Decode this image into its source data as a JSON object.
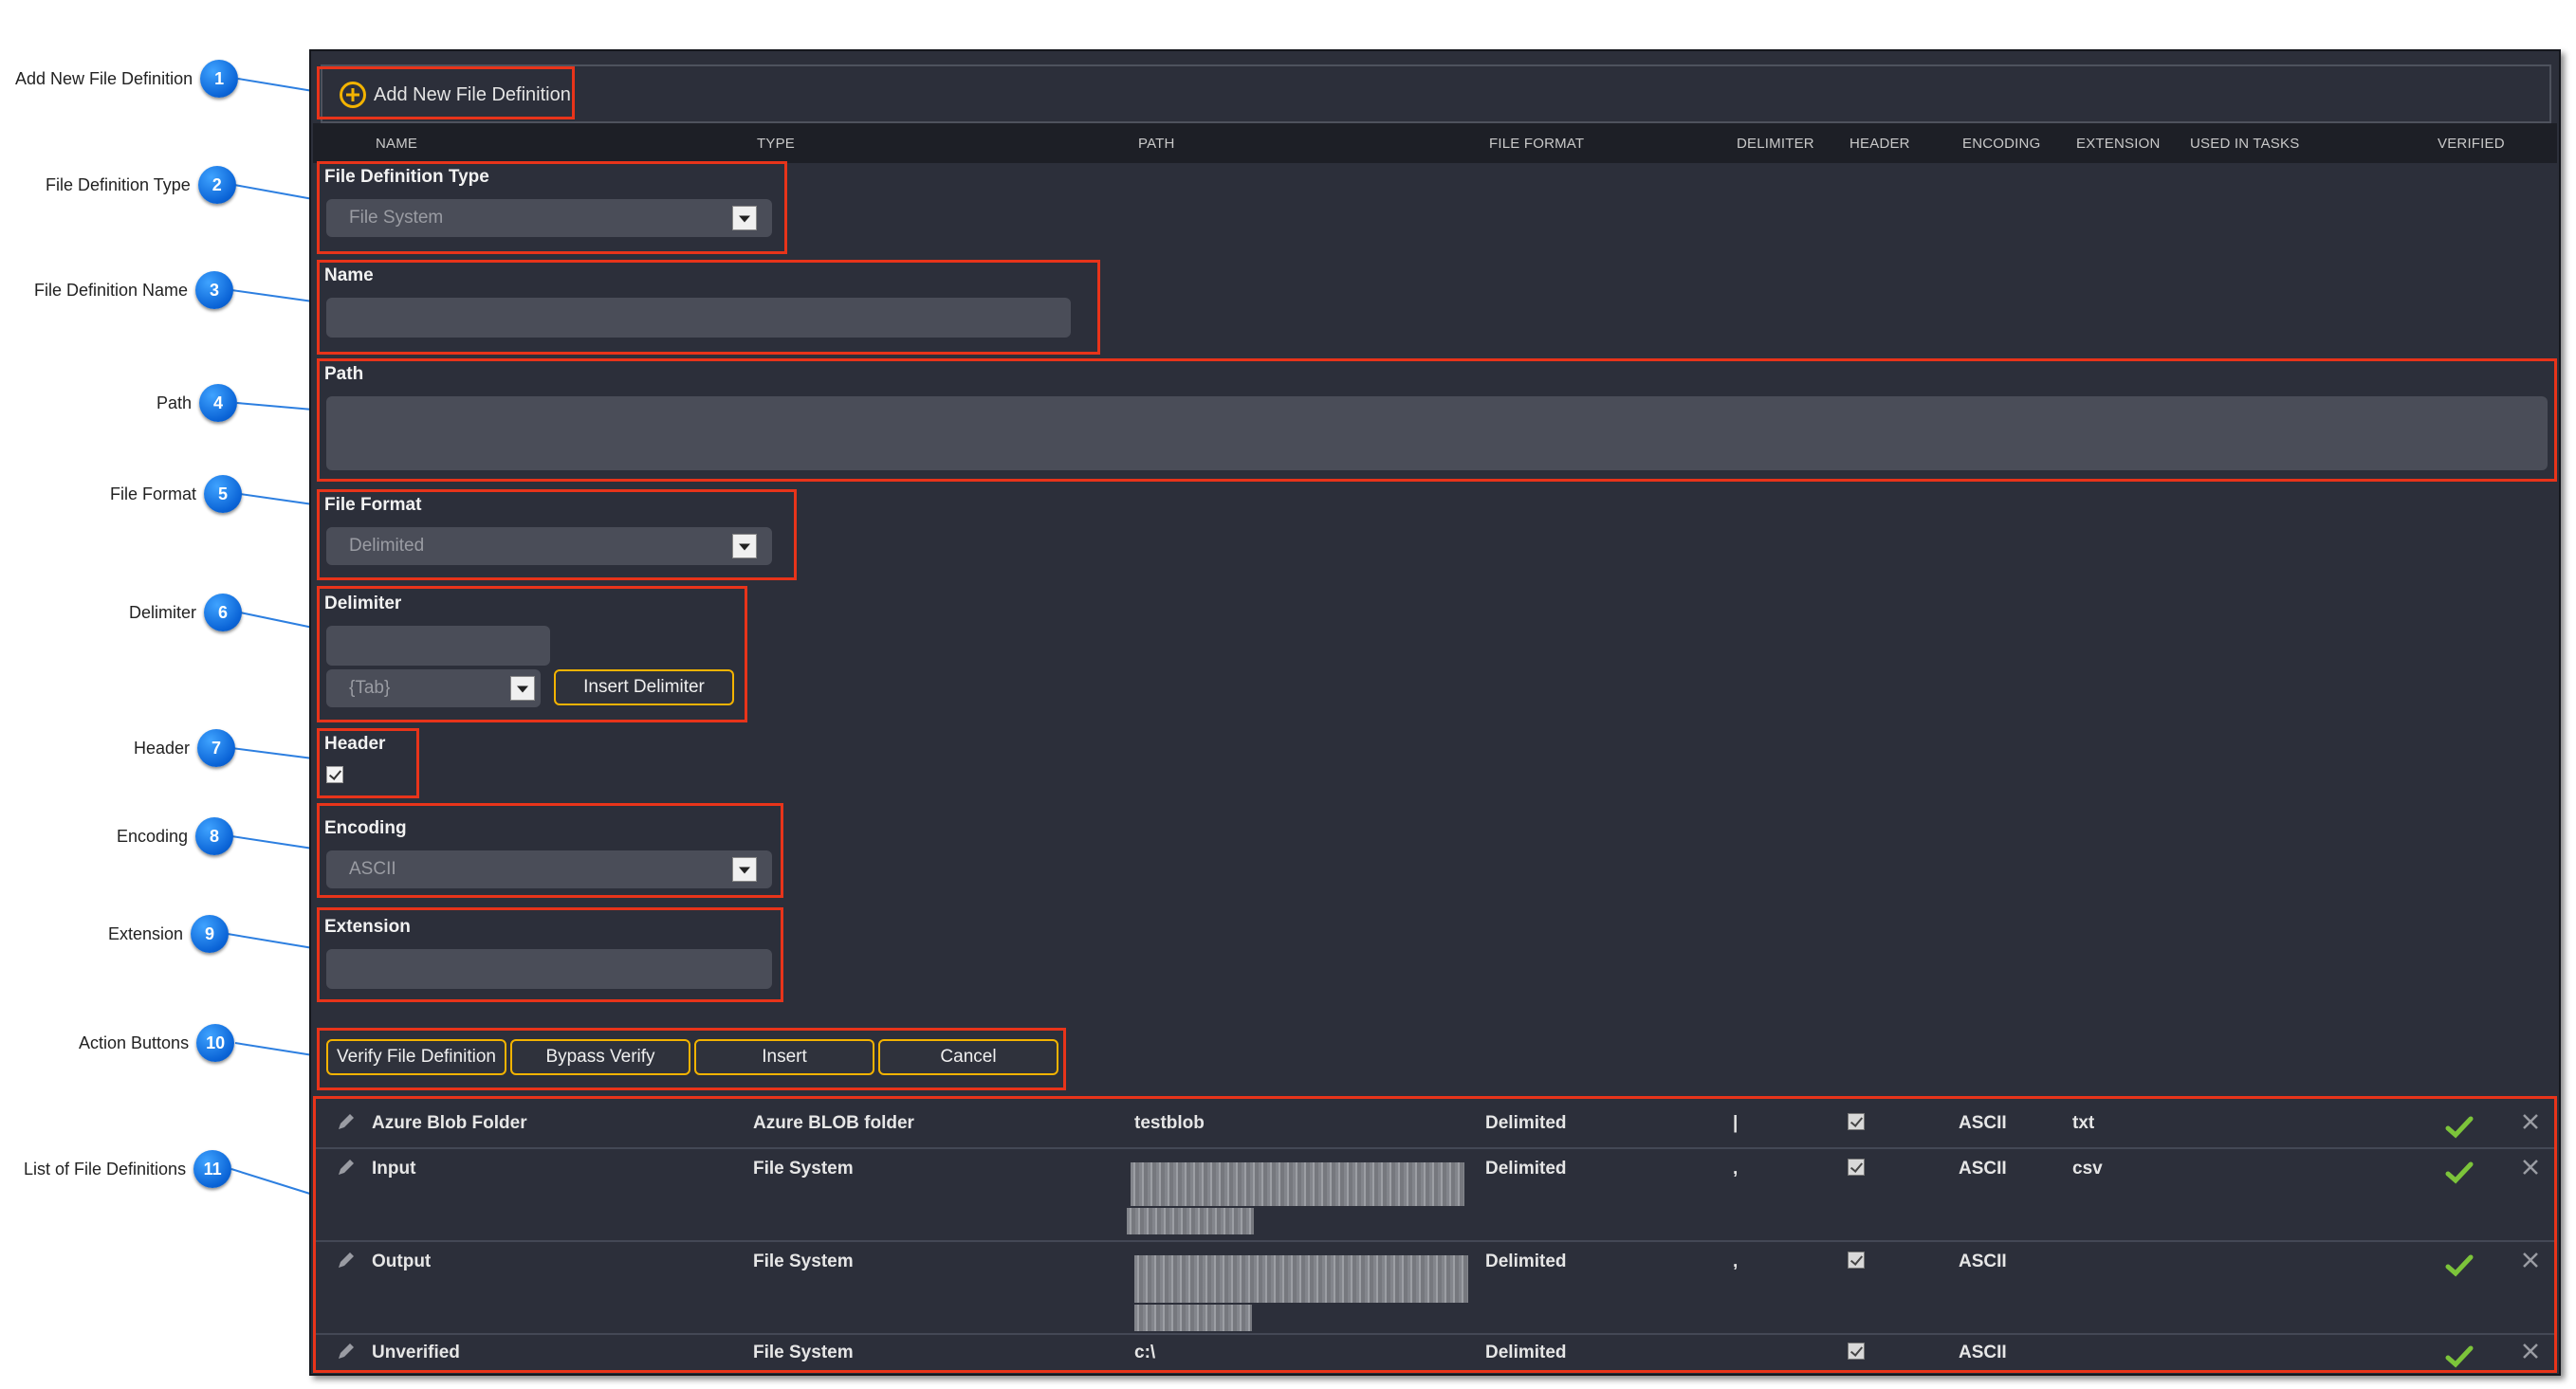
{
  "callouts": [
    {
      "num": "1",
      "label": "Add New File Definition"
    },
    {
      "num": "2",
      "label": "File Definition Type"
    },
    {
      "num": "3",
      "label": "File Definition Name"
    },
    {
      "num": "4",
      "label": "Path"
    },
    {
      "num": "5",
      "label": "File Format"
    },
    {
      "num": "6",
      "label": "Delimiter"
    },
    {
      "num": "7",
      "label": "Header"
    },
    {
      "num": "8",
      "label": "Encoding"
    },
    {
      "num": "9",
      "label": "Extension"
    },
    {
      "num": "10",
      "label": "Action Buttons"
    },
    {
      "num": "11",
      "label": "List of File Definitions"
    }
  ],
  "toolbar": {
    "add_label": "Add New File Definition",
    "add_icon": "plus-circle-icon"
  },
  "columns": {
    "name": "NAME",
    "type": "TYPE",
    "path": "PATH",
    "file_format": "FILE FORMAT",
    "delimiter": "DELIMITER",
    "header": "HEADER",
    "encoding": "ENCODING",
    "extension": "EXTENSION",
    "used_in_tasks": "USED IN TASKS",
    "verified": "VERIFIED"
  },
  "form": {
    "type_label": "File Definition Type",
    "type_value": "File System",
    "name_label": "Name",
    "name_value": "",
    "path_label": "Path",
    "path_value": "",
    "format_label": "File Format",
    "format_value": "Delimited",
    "delimiter_label": "Delimiter",
    "delimiter_value": "",
    "delimiter_select": "{Tab}",
    "insert_delimiter": "Insert Delimiter",
    "header_label": "Header",
    "header_checked": true,
    "encoding_label": "Encoding",
    "encoding_value": "ASCII",
    "extension_label": "Extension",
    "extension_value": ""
  },
  "actions": {
    "verify": "Verify File Definition",
    "bypass": "Bypass Verify",
    "insert": "Insert",
    "cancel": "Cancel"
  },
  "rows": [
    {
      "name": "Azure Blob Folder",
      "type": "Azure BLOB folder",
      "path": "testblob",
      "format": "Delimited",
      "delimiter": "|",
      "header": true,
      "encoding": "ASCII",
      "extension": "txt",
      "verified": true
    },
    {
      "name": "Input",
      "type": "File System",
      "path": "",
      "format": "Delimited",
      "delimiter": ",",
      "header": true,
      "encoding": "ASCII",
      "extension": "csv",
      "verified": true
    },
    {
      "name": "Output",
      "type": "File System",
      "path": "",
      "format": "Delimited",
      "delimiter": ",",
      "header": true,
      "encoding": "ASCII",
      "extension": "",
      "verified": true
    },
    {
      "name": "Unverified",
      "type": "File System",
      "path": "c:\\",
      "format": "Delimited",
      "delimiter": "",
      "header": true,
      "encoding": "ASCII",
      "extension": "",
      "verified": true
    }
  ],
  "colors": {
    "accent": "#f3b300",
    "highlight": "#e8341a",
    "panel": "#2c2f3a",
    "badge": "#0a63d6",
    "verified": "#7cc43a"
  }
}
